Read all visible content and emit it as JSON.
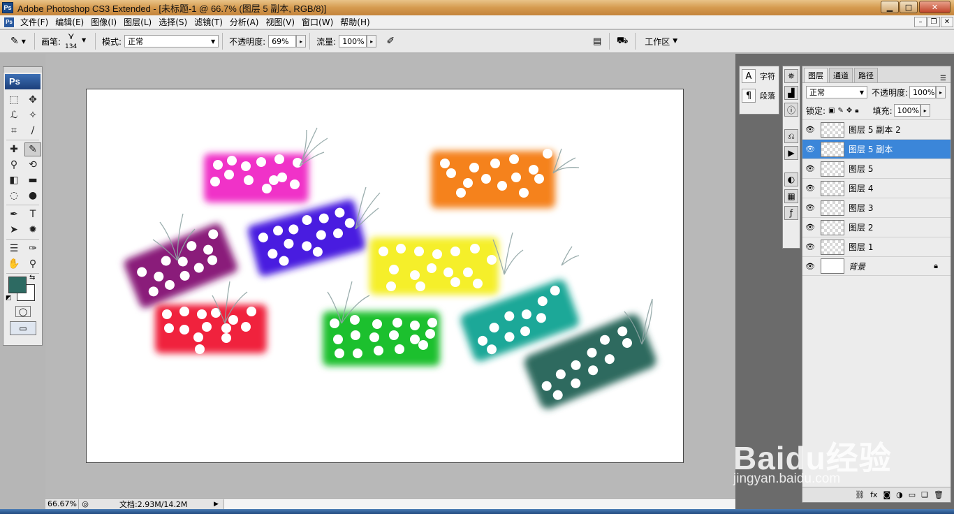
{
  "window": {
    "title": "Adobe Photoshop CS3 Extended - [未标题-1 @ 66.7% (图层 5 副本, RGB/8)]",
    "logo": "Ps",
    "min": "▁",
    "max": "□",
    "close": "✕"
  },
  "menu": {
    "doc_icon": "Ps",
    "items": [
      "文件(F)",
      "编辑(E)",
      "图像(I)",
      "图层(L)",
      "选择(S)",
      "滤镜(T)",
      "分析(A)",
      "视图(V)",
      "窗口(W)",
      "帮助(H)"
    ],
    "mdi_min": "–",
    "mdi_restore": "❐",
    "mdi_close": "✕"
  },
  "options": {
    "brush_label": "画笔:",
    "brush_size": "134",
    "mode_label": "模式:",
    "mode_value": "正常",
    "opacity_label": "不透明度:",
    "opacity_value": "69%",
    "flow_label": "流量:",
    "flow_value": "100%",
    "workspace_label": "工作区"
  },
  "toolbox": {
    "badge": "Ps"
  },
  "status": {
    "zoom": "66.67%",
    "doc_info": "文档:2.93M/14.2M"
  },
  "char_panel": {
    "char_label": "字符",
    "para_label": "段落"
  },
  "layers_panel": {
    "tabs": [
      "图层",
      "通道",
      "路径"
    ],
    "blend_mode": "正常",
    "opacity_label": "不透明度:",
    "opacity_value": "100%",
    "lock_label": "锁定:",
    "fill_label": "填充:",
    "fill_value": "100%",
    "layers": [
      {
        "name": "图层 5 副本 2",
        "selected": false
      },
      {
        "name": "图层 5 副本",
        "selected": true
      },
      {
        "name": "图层 5",
        "selected": false
      },
      {
        "name": "图层 4",
        "selected": false
      },
      {
        "name": "图层 3",
        "selected": false
      },
      {
        "name": "图层 2",
        "selected": false
      },
      {
        "name": "图层 1",
        "selected": false
      },
      {
        "name": "背景",
        "selected": false
      }
    ]
  },
  "watermark": {
    "brand": "Baidu经验",
    "url": "jingyan.baidu.com"
  },
  "colors": {
    "magenta": "#f033c8",
    "orange": "#f5821a",
    "purple": "#8a1a7a",
    "blue": "#4a1ae0",
    "yellow": "#f5ef2a",
    "red": "#f0203c",
    "green": "#1ec02e",
    "teal": "#1aa898",
    "darkteal": "#2e6a5e",
    "foreground": "#2d6a62"
  }
}
